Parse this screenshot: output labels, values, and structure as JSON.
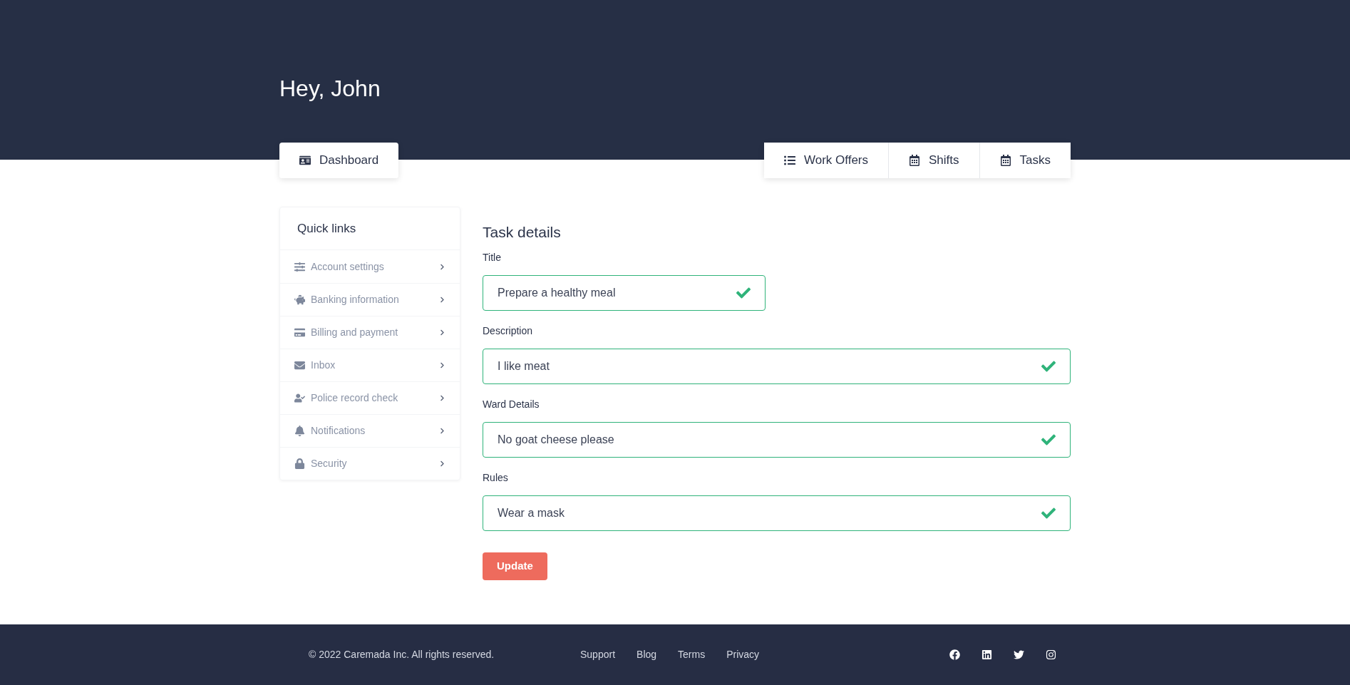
{
  "header": {
    "greeting": "Hey, John"
  },
  "nav": {
    "left": [
      {
        "label": "Dashboard"
      }
    ],
    "right": [
      {
        "label": "Work Offers"
      },
      {
        "label": "Shifts"
      },
      {
        "label": "Tasks"
      }
    ]
  },
  "sidebar": {
    "title": "Quick links",
    "items": [
      {
        "label": "Account settings"
      },
      {
        "label": "Banking information"
      },
      {
        "label": "Billing and payment"
      },
      {
        "label": "Inbox"
      },
      {
        "label": "Police record check"
      },
      {
        "label": "Notifications"
      },
      {
        "label": "Security"
      }
    ]
  },
  "form": {
    "title": "Task details",
    "fields": [
      {
        "label": "Title",
        "value": "Prepare a healthy meal",
        "kind": "short",
        "valid": true
      },
      {
        "label": "Description",
        "value": "I like meat",
        "kind": "wide",
        "valid": true
      },
      {
        "label": "Ward Details",
        "value": "No goat cheese please",
        "kind": "wide",
        "valid": true
      },
      {
        "label": "Rules",
        "value": "Wear a mask",
        "kind": "wide",
        "valid": true
      }
    ],
    "submit": "Update"
  },
  "footer": {
    "copyright": "© 2022 Caremada Inc. All rights reserved.",
    "links": [
      "Support",
      "Blog",
      "Terms",
      "Privacy"
    ]
  }
}
